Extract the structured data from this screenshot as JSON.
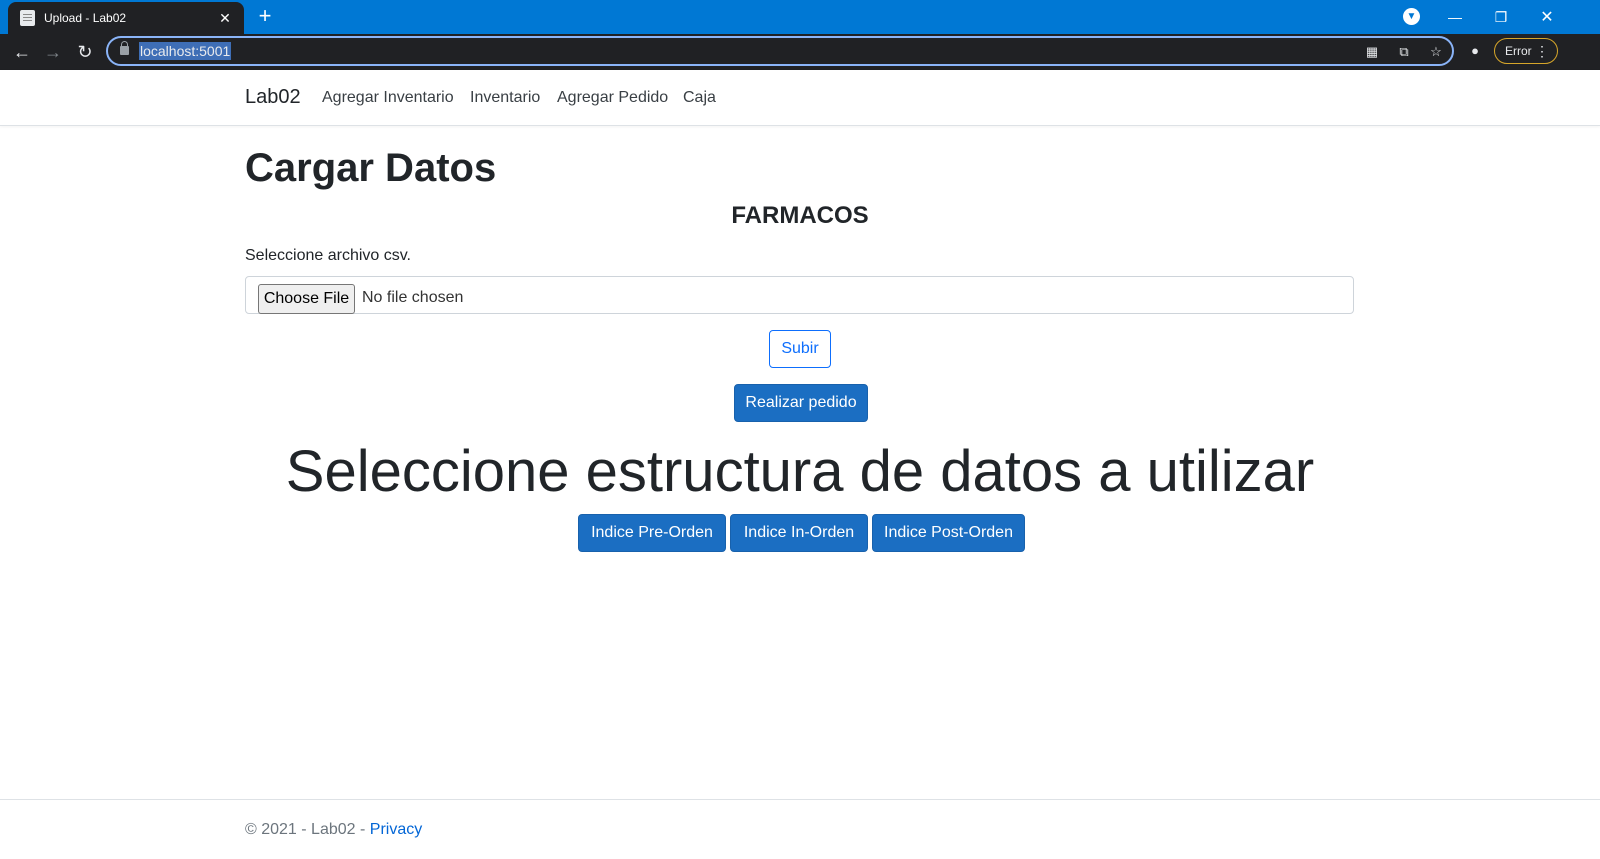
{
  "browser": {
    "tab_title": "Upload - Lab02",
    "url": "localhost:5001",
    "status_pill": "Error",
    "accent": "#0078d4"
  },
  "nav": {
    "brand": "Lab02",
    "links": [
      "Agregar Inventario",
      "Inventario",
      "Agregar Pedido",
      "Caja"
    ]
  },
  "main": {
    "title": "Cargar Datos",
    "subtitle": "FARMACOS",
    "file_label": "Seleccione archivo csv.",
    "choose_file": "Choose File",
    "no_file": "No file chosen",
    "upload_button": "Subir",
    "order_button": "Realizar pedido",
    "structure_heading": "Seleccione estructura de datos a utilizar",
    "index_buttons": [
      "Indice Pre-Orden",
      "Indice In-Orden",
      "Indice Post-Orden"
    ],
    "primary_color": "#1b6ec2"
  },
  "footer": {
    "copyright": "© 2021 - Lab02 - ",
    "privacy": "Privacy"
  }
}
